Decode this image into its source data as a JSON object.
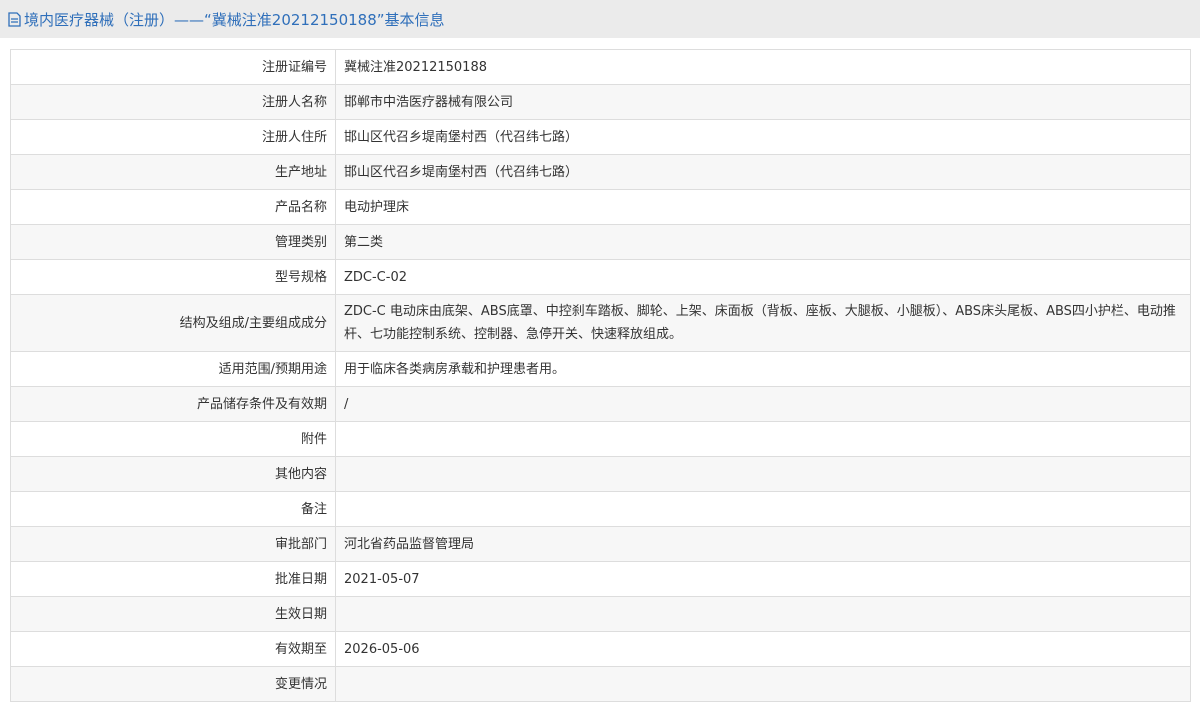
{
  "header": {
    "title": "境内医疗器械（注册）——“冀械注准20212150188”基本信息"
  },
  "rows": [
    {
      "label": "注册证编号",
      "value": "冀械注准20212150188"
    },
    {
      "label": "注册人名称",
      "value": "邯郸市中浩医疗器械有限公司"
    },
    {
      "label": "注册人住所",
      "value": "邯山区代召乡堤南堡村西（代召纬七路）"
    },
    {
      "label": "生产地址",
      "value": "邯山区代召乡堤南堡村西（代召纬七路）"
    },
    {
      "label": "产品名称",
      "value": "电动护理床"
    },
    {
      "label": "管理类别",
      "value": "第二类"
    },
    {
      "label": "型号规格",
      "value": "ZDC-C-02"
    },
    {
      "label": "结构及组成/主要组成成分",
      "value": "ZDC-C 电动床由底架、ABS底罩、中控刹车踏板、脚轮、上架、床面板（背板、座板、大腿板、小腿板）、ABS床头尾板、ABS四小护栏、电动推杆、七功能控制系统、控制器、急停开关、快速释放组成。"
    },
    {
      "label": "适用范围/预期用途",
      "value": "用于临床各类病房承载和护理患者用。"
    },
    {
      "label": "产品储存条件及有效期",
      "value": "/"
    },
    {
      "label": "附件",
      "value": ""
    },
    {
      "label": "其他内容",
      "value": ""
    },
    {
      "label": "备注",
      "value": ""
    },
    {
      "label": "审批部门",
      "value": "河北省药品监督管理局"
    },
    {
      "label": "批准日期",
      "value": "2021-05-07"
    },
    {
      "label": "生效日期",
      "value": ""
    },
    {
      "label": "有效期至",
      "value": "2026-05-06"
    },
    {
      "label": "变更情况",
      "value": ""
    }
  ]
}
